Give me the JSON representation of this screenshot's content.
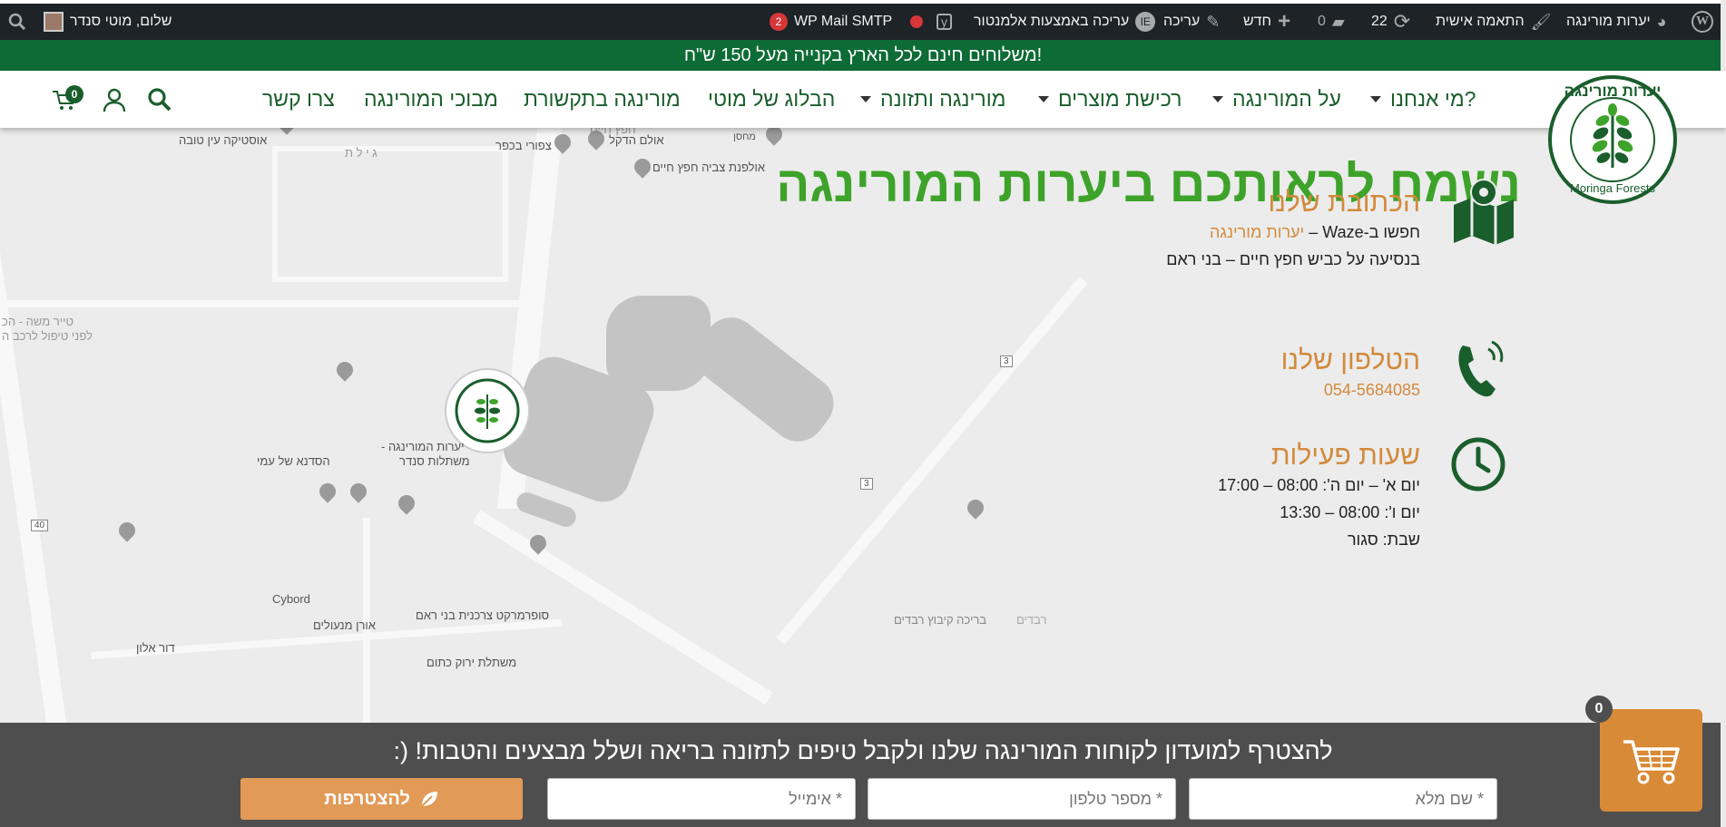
{
  "admin_bar": {
    "site_name": "יערות מורינגה",
    "customize": "התאמה אישית",
    "updates_count": "22",
    "comments_count": "0",
    "new_label": "חדש",
    "edit_label": "עריכה",
    "elementor_label": "עריכה באמצעות אלמנטור",
    "wp_mail_smtp": "WP Mail SMTP",
    "wp_mail_badge": "2",
    "greeting": "שלום, מוטי סנדר"
  },
  "banner": {
    "text": "משלוחים חינם לכל הארץ בקנייה מעל 150 ש\"ח!"
  },
  "nav": {
    "items": [
      {
        "label": "מי אנחנו?",
        "has_dropdown": true
      },
      {
        "label": "על המורינגה",
        "has_dropdown": true
      },
      {
        "label": "רכישת מוצרים",
        "has_dropdown": true
      },
      {
        "label": "מורינגה ותזונה",
        "has_dropdown": true
      },
      {
        "label": "הבלוג של מוטי",
        "has_dropdown": false
      },
      {
        "label": "מורינגה בתקשורת",
        "has_dropdown": false
      },
      {
        "label": "מבוכי המורינגה",
        "has_dropdown": false
      },
      {
        "label": "צרו קשר",
        "has_dropdown": false
      }
    ],
    "cart_count": "0",
    "logo_text": "יערות מורינגה",
    "logo_sub": "Moringa Forests"
  },
  "contact": {
    "headline": "נשמח לראותכם ביערות המורינגה",
    "address_title": "הכתובת שלנו",
    "address_line1_prefix": "חפשו ב-Waze –",
    "address_line1_link": "יערות מורינגה",
    "address_line2": "בנסיעה על כביש חפץ חיים – בני ראם",
    "phone_title": "הטלפון שלנו",
    "phone": "054-5684085",
    "hours_title": "שעות פעילות",
    "hours_1": "יום א' – יום ה': 08:00 – 17:00",
    "hours_2": "יום ו': 08:00 – 13:30",
    "hours_3": "שבת: סגור"
  },
  "map": {
    "labels": {
      "l1": "אוסטיקה עין טובה",
      "l2": "חפץ חיים",
      "l3": "ג י ל ת",
      "l4": "מחסן",
      "l5": "אולם הדקל",
      "l6": "צפורי בכפר",
      "l7": "אולפנת צביה חפץ חיים",
      "l8": "טייר משה - הכ",
      "l9": "לפני טיפול לרכב ה",
      "l10": "יערות המורינגה -",
      "l11": "משתלות סנדר",
      "l12": "הסדנא של עמי",
      "l13": "Cybord",
      "l14": "סופרמרקט צרכנית בני ראם",
      "l15": "אורן מנעולים",
      "l16": "דור אלון",
      "l17": "משתלת ירוק כתום",
      "l18": "בריכה קיבוץ רבדים",
      "l19": "רבדים",
      "r40": "40",
      "r3a": "3",
      "r3b": "3"
    }
  },
  "signup": {
    "title": "להצטרף למועדון לקוחות המורינגה שלנו ולקבל טיפים לתזונה בריאה ושלל מבצעים והטבות! (:",
    "name_placeholder": "* שם מלא",
    "phone_placeholder": "* מספר טלפון",
    "email_placeholder": "* אימייל",
    "join_label": "להצטרפות"
  },
  "floating_cart": {
    "count": "0"
  },
  "colors": {
    "brand_green": "#0d6b35",
    "headline_green": "#3ea32a",
    "accent_orange": "#d28a3c"
  }
}
